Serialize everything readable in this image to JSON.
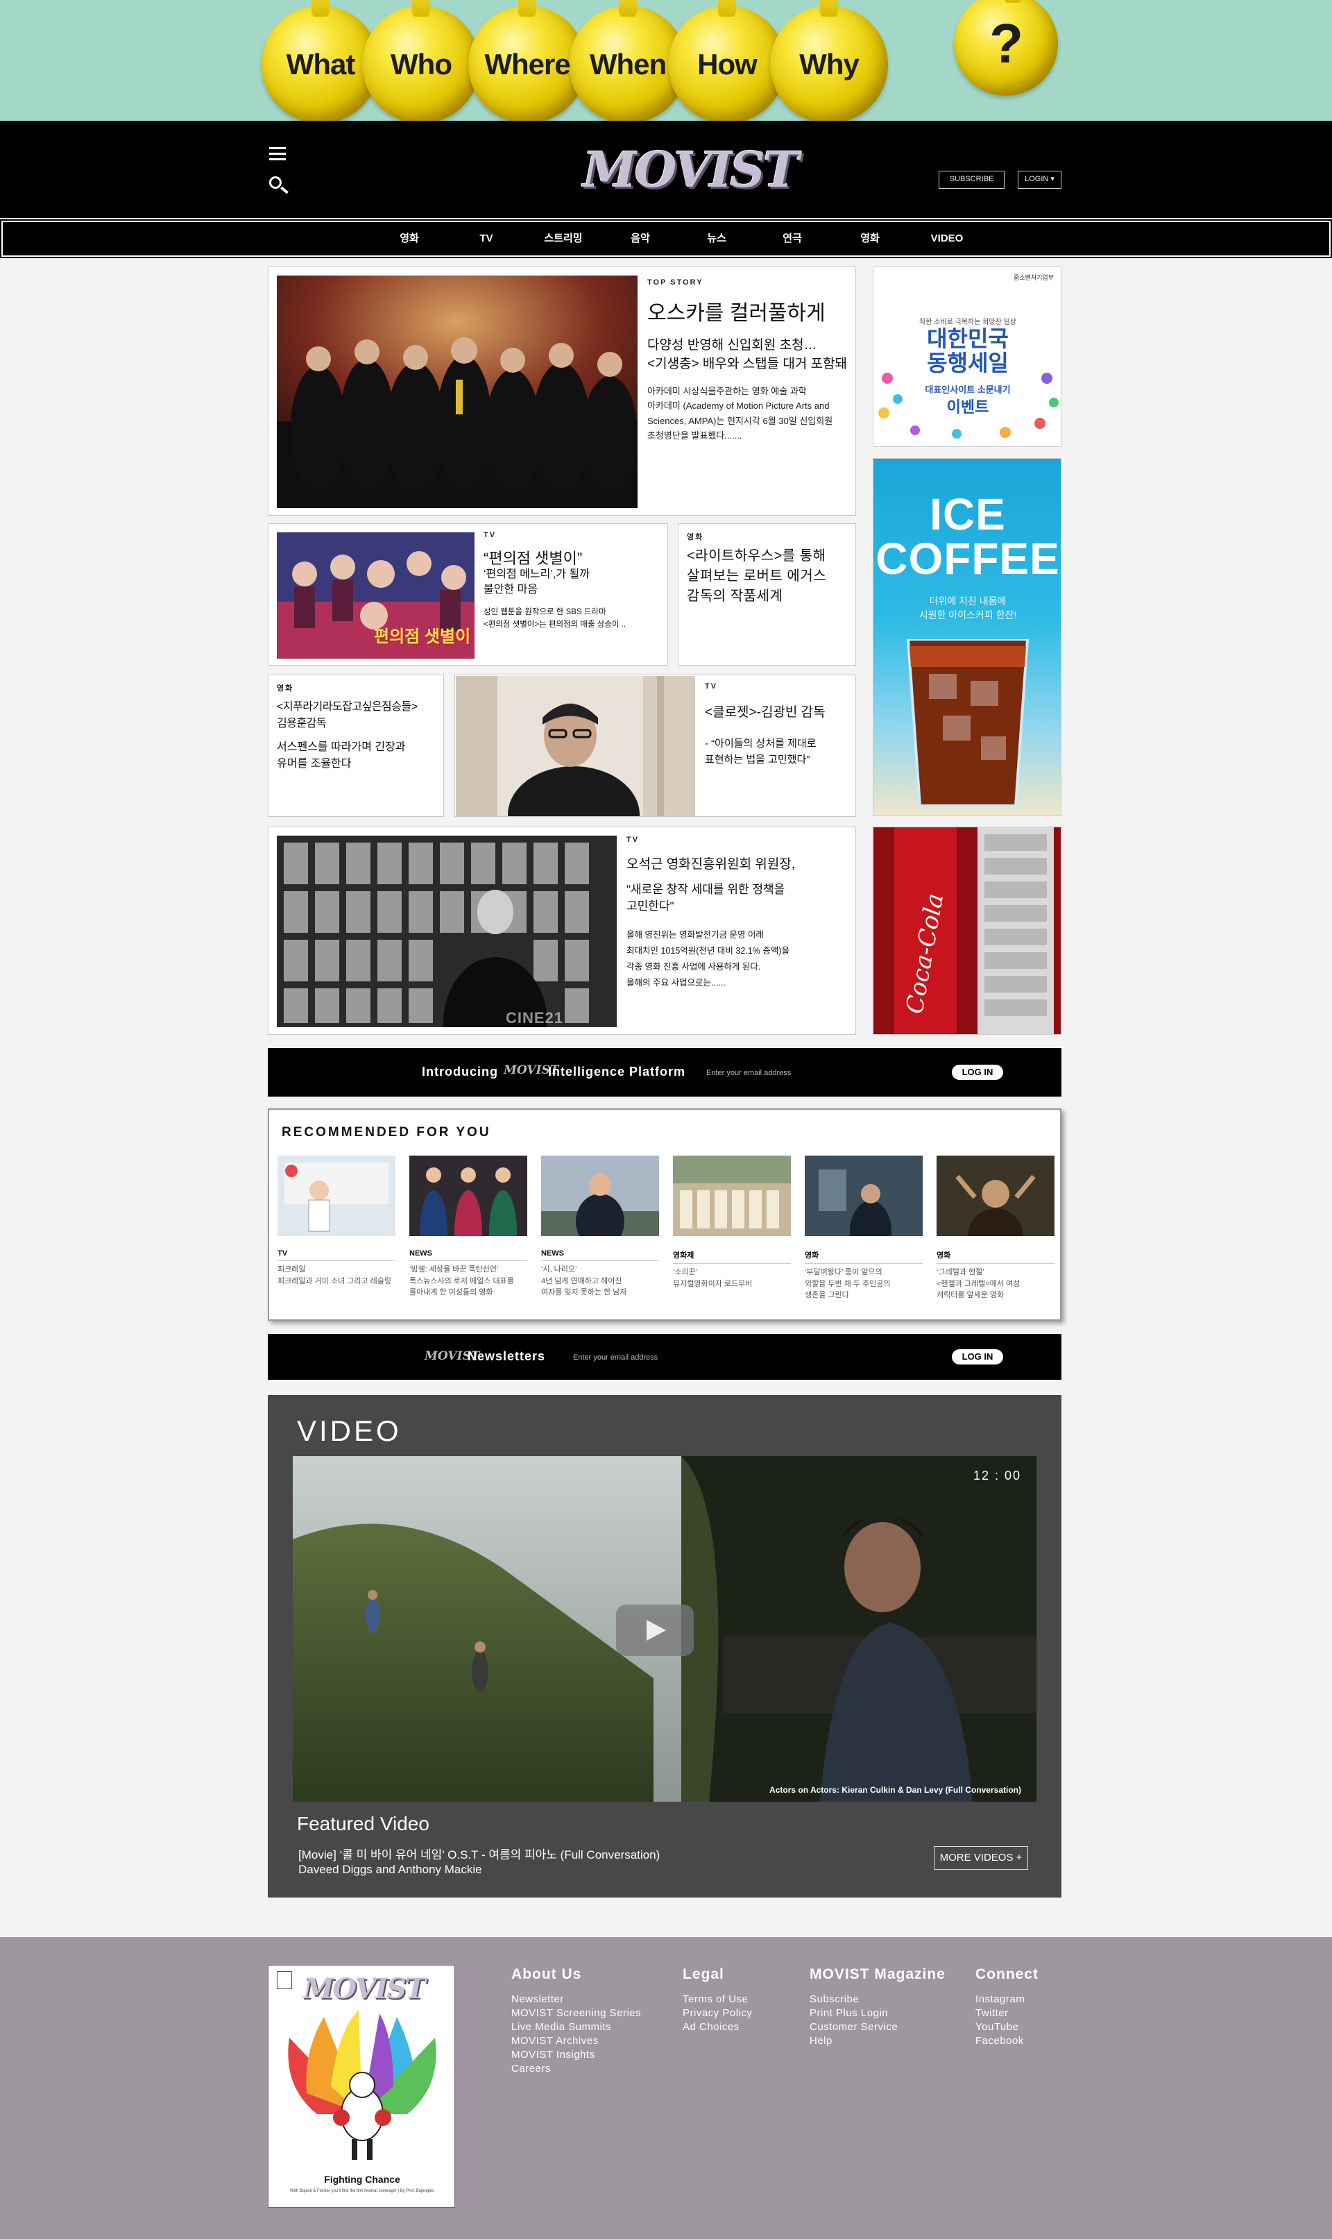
{
  "top_banner": {
    "bubbles": [
      "What",
      "Who",
      "Where",
      "When",
      "How",
      "Why"
    ],
    "question_mark": "?"
  },
  "header": {
    "logo": "MOVIST",
    "subscribe_label": "SUBSCRIBE",
    "login_label": "LOGIN ▾"
  },
  "nav": {
    "items": [
      "영화",
      "TV",
      "스트리밍",
      "음악",
      "뉴스",
      "연극",
      "영화",
      "VIDEO"
    ]
  },
  "top_story": {
    "tag": "TOP  STORY",
    "headline": "오스카를 컬러풀하게",
    "subhead": "다양성 반영해 신입회원 초청…\n<기생충> 배우와 스탭들 대거 포함돼",
    "body": "아카데미 시상식을주관하는 영화 예술 과학\n아카데미 (Academy of Motion Picture Arts and\nSciences, AMPA)는 현지시각 6월 30일 신입회원\n초청명단을 발표했다......."
  },
  "card_convenience": {
    "tag": "TV",
    "headline": "“편의점 샛별이”",
    "subhead": "‘편의점 메느리’,가 될까\n불안한 마음",
    "body": "성인 웹툰을 원작으로 한 SBS 드라마\n<편의점 샛별이>는 편의점의 매출 상승이 ..",
    "poster_text": "편의점 샛별이"
  },
  "card_lighthouse": {
    "tag": "영화",
    "headline": "<라이트하우스>를 통해\n살펴보는 로버트 에거스\n감독의 작품세계"
  },
  "card_jipuragi": {
    "tag": "영화",
    "headline": "<지푸라기라도잡고싶은짐승들>\n김용훈감독",
    "body": "서스펜스를 따라가며 긴장과\n유머를 조율한다"
  },
  "card_closet": {
    "tag": "TV",
    "headline": "<클로젯>-김광빈 감독",
    "body": "- “아이들의 상처를 제대로\n표현하는 법을 고민했다”"
  },
  "card_oseokgeun": {
    "tag": "TV",
    "headline": "오석근 영화진흥위원회 위원장,",
    "subhead": "\"새로운 창작 세대를 위한 정책을\n고민한다\"",
    "body": "올해 영진위는 영화발전기금 운영 이래\n최대치인 1015억원(전년 대비 32.1% 증액)을\n각종 영화 진흥 사업에 사용하게 된다.\n올해의 주요 사업으로는......",
    "watermark": "CINE21"
  },
  "ads": {
    "ad1_top": "중소벤처기업부",
    "ad1_small": "착한 소비로 극복하는 희망찬 일상",
    "ad1_main": "대한민국\n동행세일",
    "ad1_sub": "대표인사이트 소문내기",
    "ad1_event": "이벤트",
    "ad2_title": "ICE\nCOFFEE",
    "ad2_sub": "더위에 지친 내몸에\n시원한 아이스커피 한잔!",
    "ad3_text": "Coca-Cola"
  },
  "intel_bar": {
    "pre": "Introducing",
    "brand": "MOVIST",
    "post": "Intelligence Platform",
    "email_placeholder": "Enter your email address",
    "button": "LOG IN"
  },
  "recommended": {
    "title": "RECOMMENDED FOR YOU",
    "items": [
      {
        "tag": "TV",
        "text": "피크레일\n피크레일과 거미 소녀 그리고 레슬링"
      },
      {
        "tag": "NEWS",
        "text": "‘밤쉘: 세상을 바꾼 폭탄선언’\n폭스뉴스사의 로저 에일스 대표를\n몰아내게 한 여성들의 영화"
      },
      {
        "tag": "NEWS",
        "text": "‘시, 나리오’\n4년 넘게 연애하고 헤어진\n여자를 잊지 못하는 한 남자"
      },
      {
        "tag": "영화제",
        "text": "‘소리꾼’\n뮤지컬영화이자 로드무비"
      },
      {
        "tag": "영화",
        "text": "‘부달여왕다’ 종이 앞으의\n외할을 두번 채 두 주인공의\n생존을 그린다"
      },
      {
        "tag": "영화",
        "text": "‘그레텔과 헨젤’\n<헨젤과 그레텔>에서 여성\n캐릭터를 앞세운 영화"
      }
    ]
  },
  "newsletter_bar": {
    "brand": "MOVIST",
    "label": "Newsletters",
    "email_placeholder": "Enter your email address",
    "button": "LOG IN"
  },
  "video": {
    "section_title": "VIDEO",
    "timestamp": "12 : 00",
    "caption": "Actors on Actors: Kieran Culkin & Dan Levy (Full Conversation)",
    "featured_label": "Featured Video",
    "line1": "[Movie] ‘콜 미 바이 유어 네임’ O.S.T - 여름의 피아노 (Full Conversation)",
    "line2": "Daveed Diggs and Anthony Mackie",
    "more_button": "MORE VIDEOS  +"
  },
  "footer": {
    "magazine_logo": "MOVIST",
    "magazine_caption": "Fighting Chance",
    "magazine_fine": "With Bojack & Forster you'll find the film festival coverage! | By Prof. Bojangles",
    "columns": [
      {
        "title": "About Us",
        "links": [
          "Newsletter",
          "MOVIST Screening Series",
          "Live Media Summits",
          "MOVIST Archives",
          "MOVIST Insights",
          "Careers"
        ]
      },
      {
        "title": "Legal",
        "links": [
          "Terms of Use",
          "Privacy Policy",
          "Ad Choices"
        ]
      },
      {
        "title": "MOVIST Magazine",
        "links": [
          "Subscribe",
          "Print Plus Login",
          "Customer Service",
          "Help"
        ]
      },
      {
        "title": "Connect",
        "links": [
          "Instagram",
          "Twitter",
          "YouTube",
          "Facebook"
        ]
      }
    ]
  },
  "colors": {
    "banner_bg": "#a3d8c8",
    "footer_bg": "#9f97a0",
    "video_bg": "#484848",
    "bubble_yellow": "#f4dc1c"
  }
}
